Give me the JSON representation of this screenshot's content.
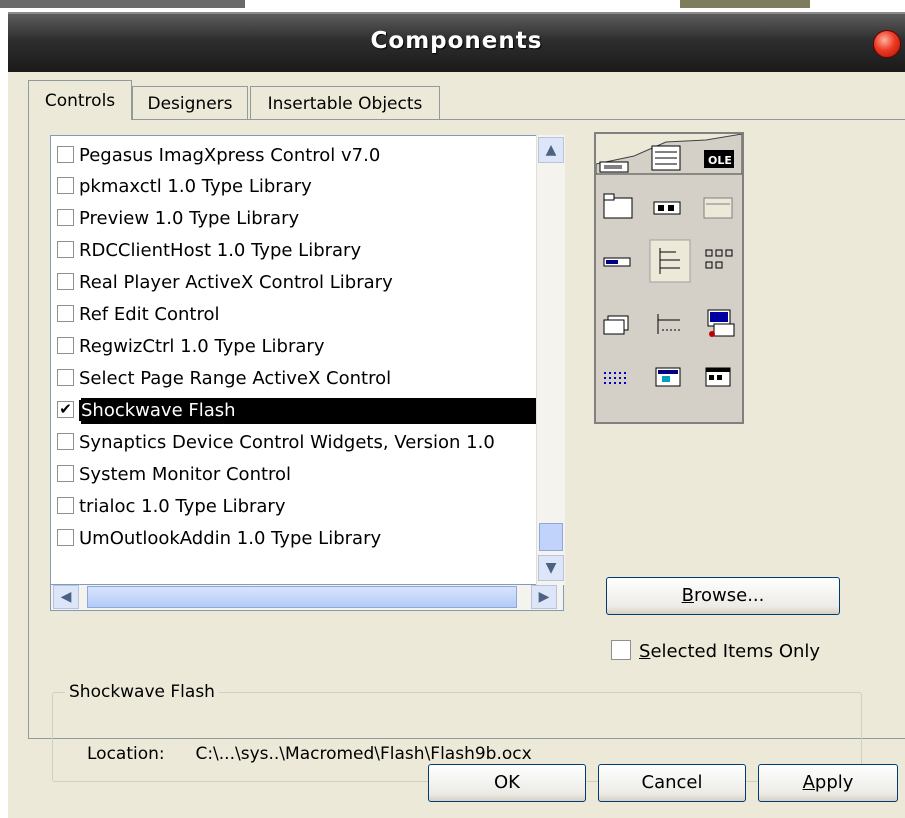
{
  "window": {
    "title": "Components"
  },
  "tabs": [
    {
      "label": "Controls",
      "active": true
    },
    {
      "label": "Designers",
      "active": false
    },
    {
      "label": "Insertable Objects",
      "active": false
    }
  ],
  "components_list": [
    {
      "label": "Pegasus ImagXpress Control v7.0",
      "checked": false,
      "selected": false
    },
    {
      "label": "pkmaxctl 1.0 Type Library",
      "checked": false,
      "selected": false
    },
    {
      "label": "Preview 1.0 Type Library",
      "checked": false,
      "selected": false
    },
    {
      "label": "RDCClientHost 1.0 Type Library",
      "checked": false,
      "selected": false
    },
    {
      "label": "Real Player ActiveX Control Library",
      "checked": false,
      "selected": false
    },
    {
      "label": "Ref Edit Control",
      "checked": false,
      "selected": false
    },
    {
      "label": "RegwizCtrl 1.0 Type Library",
      "checked": false,
      "selected": false
    },
    {
      "label": "Select Page Range ActiveX Control",
      "checked": false,
      "selected": false
    },
    {
      "label": "Shockwave Flash",
      "checked": true,
      "selected": true
    },
    {
      "label": "Synaptics Device Control Widgets, Version 1.0",
      "checked": false,
      "selected": false
    },
    {
      "label": "System Monitor Control",
      "checked": false,
      "selected": false
    },
    {
      "label": "trialoc 1.0 Type Library",
      "checked": false,
      "selected": false
    },
    {
      "label": "UmOutlookAddin 1.0 Type Library",
      "checked": false,
      "selected": false
    }
  ],
  "buttons": {
    "browse_prefix": "B",
    "browse_rest": "rowse...",
    "ok": "OK",
    "cancel": "Cancel",
    "apply_prefix": "A",
    "apply_rest": "pply"
  },
  "selected_only": {
    "prefix": "S",
    "rest": "elected Items Only",
    "checked": false
  },
  "details": {
    "group_title": "Shockwave Flash",
    "location_label": "Location:",
    "location_value": "C:\\...\\sys..\\Macromed\\Flash\\Flash9b.ocx"
  },
  "palette_icons": [
    "ole-icon",
    "frame-icon",
    "command-button-icon",
    "combobox-icon",
    "progressbar-icon",
    "treeview-icon",
    "listview-icon",
    "tabstrip-icon",
    "statusbar-icon",
    "connector-icon",
    "imagelist-icon",
    "animation-icon",
    "calendar-icon",
    "toolbar-icon"
  ]
}
